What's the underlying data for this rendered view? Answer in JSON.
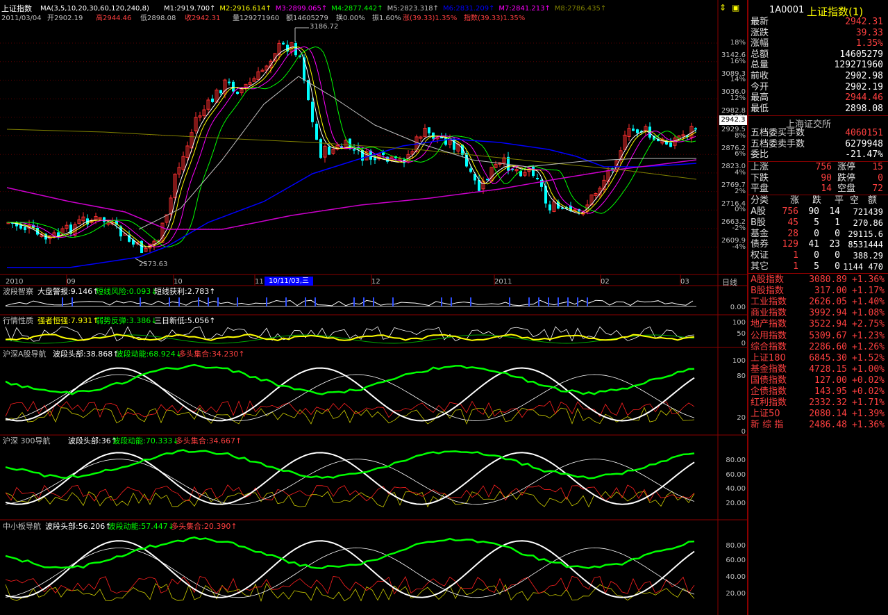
{
  "main": {
    "title": "上证指数",
    "ma_header": "MA(3,5,10,20,30,60,120,240,8)",
    "ma_values": [
      {
        "label": "M1:2919.700",
        "color": "#ffffff"
      },
      {
        "label": "M2:2916.614",
        "color": "#ffff00"
      },
      {
        "label": "M3:2899.065",
        "color": "#ff00ff"
      },
      {
        "label": "M4:2877.442",
        "color": "#00ff00"
      },
      {
        "label": "M5:2823.318",
        "color": "#c0c0c0"
      },
      {
        "label": "M6:2831.209",
        "color": "#0000ff"
      },
      {
        "label": "M7:2841.213",
        "color": "#ff00ff"
      },
      {
        "label": "M8:2786.435",
        "color": "#808000"
      }
    ],
    "info_line": {
      "date": "2011/03/04",
      "open": "开2902.19",
      "high": "高2944.46",
      "low": "低2898.08",
      "close": "收2942.31",
      "volume": "量129271960",
      "amount": "额14605279",
      "turnover": "换0.00%",
      "amplitude": "振1.60%",
      "change": "涨(39.33)1.35%",
      "index_change": "指数(39.33)1.35%"
    },
    "high_label": "3186.72",
    "low_label": "2573.63",
    "price_axis": [
      "3142.6",
      "3089.3",
      "3036.0",
      "2982.8",
      "2929.5",
      "2876.2",
      "2823.0",
      "2769.7",
      "2716.4",
      "2663.2",
      "2609.9"
    ],
    "pct_axis": [
      "18%",
      "16%",
      "14%",
      "12%",
      "10%",
      "8%",
      "6%",
      "4%",
      "2%",
      "0%",
      "-2%",
      "-4%"
    ],
    "current_price_tag": "2942.3",
    "date_axis": [
      "2010",
      "09",
      "10",
      "11",
      "12",
      "2011",
      "02",
      "03"
    ],
    "cursor_date": "10/11/03,三",
    "period_button": "日线"
  },
  "panels": [
    {
      "name": "波段智察",
      "items": [
        {
          "t": "大盘警报:9.146",
          "c": "#ffffff"
        },
        {
          "t": "短线风险:0.093",
          "c": "#00ff00"
        },
        {
          "t": "短线获利:2.783",
          "c": "#ffffff"
        }
      ],
      "axis": [
        "0.00"
      ]
    },
    {
      "name": "行情性质",
      "items": [
        {
          "t": "强者恒强:7.931",
          "c": "#ffff00"
        },
        {
          "t": "弱势反弹:3.386",
          "c": "#00ff00"
        },
        {
          "t": "三日新低:5.056",
          "c": "#ffffff"
        }
      ],
      "axis": [
        "100",
        "50",
        "0"
      ]
    },
    {
      "name": "沪深A股导航",
      "items": [
        {
          "t": "波段头部:38.868",
          "c": "#ffffff"
        },
        {
          "t": "波段动能:68.924",
          "c": "#00ff00"
        },
        {
          "t": "多头集合:34.230",
          "c": "#ff4040"
        }
      ],
      "axis": [
        "100",
        "80",
        "20",
        "0"
      ]
    },
    {
      "name": "沪深 300导航",
      "items": [
        {
          "t": "波段头部:36",
          "c": "#ffffff"
        },
        {
          "t": "波段动能:70.333",
          "c": "#00ff00"
        },
        {
          "t": "多头集合:34.667",
          "c": "#ff4040"
        }
      ],
      "axis": [
        "80.00",
        "60.00",
        "40.00",
        "20.00"
      ]
    },
    {
      "name": "中小板导航",
      "items": [
        {
          "t": "波段头部:56.206",
          "c": "#ffffff"
        },
        {
          "t": "波段动能:57.447",
          "c": "#00ff00"
        },
        {
          "t": "多头集合:20.390",
          "c": "#ff4040"
        }
      ],
      "axis": [
        "80.00",
        "60.00",
        "40.00",
        "20.00"
      ]
    }
  ],
  "quote": {
    "code": "1A0001",
    "name": "上证指数(1)",
    "rows": [
      {
        "label": "最新",
        "value": "2942.31",
        "color": "red"
      },
      {
        "label": "涨跌",
        "value": "39.33",
        "color": "red"
      },
      {
        "label": "涨幅",
        "value": "1.35%",
        "color": "red"
      },
      {
        "label": "总额",
        "value": "14605279",
        "color": "wht"
      },
      {
        "label": "总量",
        "value": "129271960",
        "color": "wht"
      },
      {
        "label": "前收",
        "value": "2902.98",
        "color": "wht"
      },
      {
        "label": "今开",
        "value": "2902.19",
        "color": "wht"
      },
      {
        "label": "最高",
        "value": "2944.46",
        "color": "red"
      },
      {
        "label": "最低",
        "value": "2898.08",
        "color": "wht"
      }
    ],
    "exchange": "上海证交所",
    "depth": [
      {
        "label": "五档委买手数",
        "value": "4060151",
        "color": "red"
      },
      {
        "label": "五档委卖手数",
        "value": "6279948",
        "color": "wht"
      },
      {
        "label": "委比",
        "value": "-21.47%",
        "color": "wht"
      }
    ],
    "breadth": [
      {
        "l1": "上涨",
        "v1": "756",
        "l2": "涨停",
        "v2": "15"
      },
      {
        "l1": "下跌",
        "v1": "90",
        "l2": "跌停",
        "v2": "0"
      },
      {
        "l1": "平盘",
        "v1": "14",
        "l2": "空盘",
        "v2": "72"
      }
    ],
    "cat_header": [
      "分类",
      "涨",
      "跌",
      "平",
      "空",
      "额"
    ],
    "categories": [
      {
        "name": "A股",
        "up": "756",
        "dn": "90",
        "fl": "14",
        "amt": "721439"
      },
      {
        "name": "B股",
        "up": "45",
        "dn": "5",
        "fl": "1",
        "amt": "270.86"
      },
      {
        "name": "基金",
        "up": "28",
        "dn": "0",
        "fl": "0",
        "amt": "29115.6"
      },
      {
        "name": "债券",
        "up": "129",
        "dn": "41",
        "fl": "23",
        "amt": "8531444"
      },
      {
        "name": "权证",
        "up": "1",
        "dn": "0",
        "fl": "0",
        "amt": "388.29"
      },
      {
        "name": "其它",
        "up": "1",
        "dn": "5",
        "fl": "0",
        "amt": "1144 470"
      }
    ],
    "indices": [
      {
        "name": "A股指数",
        "value": "3080.89",
        "chg": "+1.36%"
      },
      {
        "name": "B股指数",
        "value": "317.00",
        "chg": "+1.17%"
      },
      {
        "name": "工业指数",
        "value": "2626.05",
        "chg": "+1.40%"
      },
      {
        "name": "商业指数",
        "value": "3992.94",
        "chg": "+1.08%"
      },
      {
        "name": "地产指数",
        "value": "3522.94",
        "chg": "+2.75%"
      },
      {
        "name": "公用指数",
        "value": "5309.67",
        "chg": "+1.23%"
      },
      {
        "name": "综合指数",
        "value": "2286.60",
        "chg": "+1.26%"
      },
      {
        "name": "上证180",
        "value": "6845.30",
        "chg": "+1.52%"
      },
      {
        "name": "基金指数",
        "value": "4728.15",
        "chg": "+1.00%"
      },
      {
        "name": "国债指数",
        "value": "127.00",
        "chg": "+0.02%"
      },
      {
        "name": "企债指数",
        "value": "143.95",
        "chg": "+0.02%"
      },
      {
        "name": "红利指数",
        "value": "2332.32",
        "chg": "+1.71%"
      },
      {
        "name": "上证50",
        "value": "2080.14",
        "chg": "+1.39%"
      },
      {
        "name": "新 综 指",
        "value": "2486.48",
        "chg": "+1.36%"
      }
    ]
  }
}
